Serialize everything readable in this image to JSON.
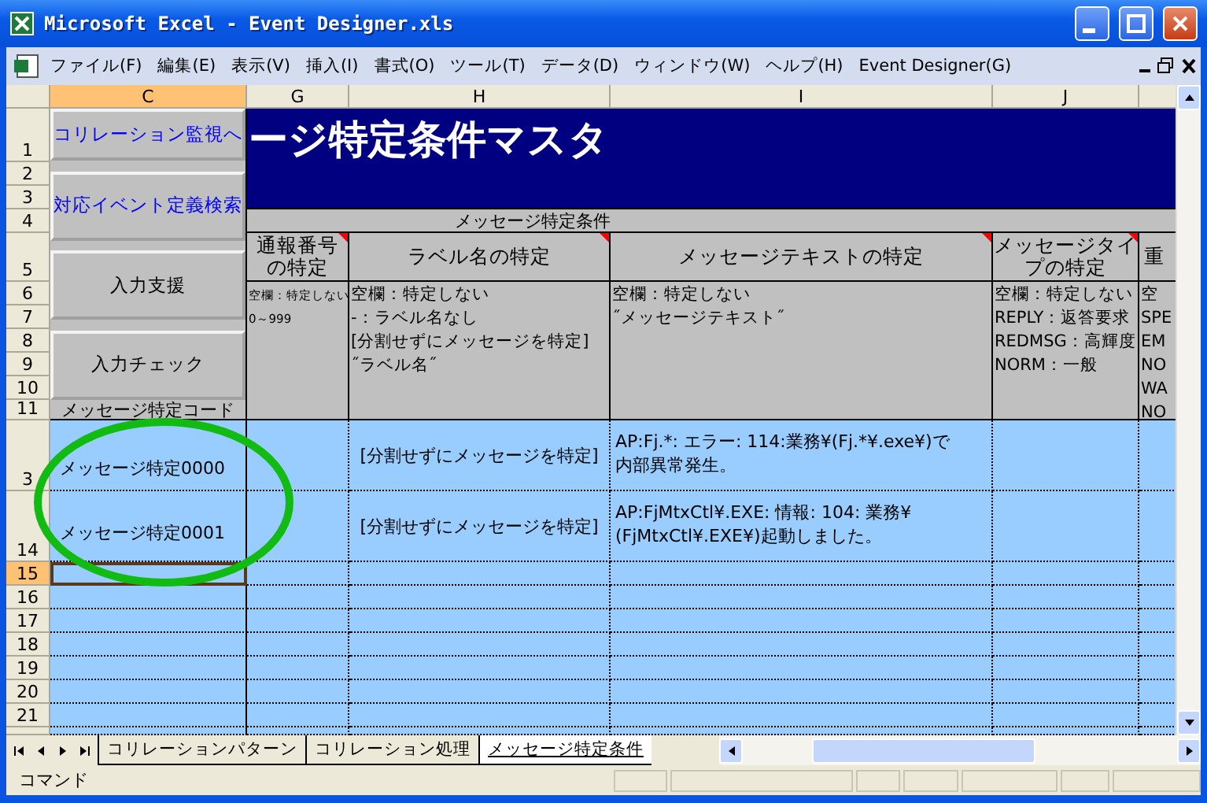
{
  "window": {
    "title": "Microsoft Excel - Event Designer.xls"
  },
  "menu": [
    "ファイル(F)",
    "編集(E)",
    "表示(V)",
    "挿入(I)",
    "書式(O)",
    "ツール(T)",
    "データ(D)",
    "ウィンドウ(W)",
    "ヘルプ(H)",
    "Event Designer(G)"
  ],
  "columns": [
    {
      "label": "C",
      "selected": true
    },
    {
      "label": "G",
      "selected": false
    },
    {
      "label": "H",
      "selected": false
    },
    {
      "label": "I",
      "selected": false
    },
    {
      "label": "J",
      "selected": false
    }
  ],
  "row_numbers": [
    {
      "label": "1",
      "selected": false
    },
    {
      "label": "2",
      "selected": false
    },
    {
      "label": "3",
      "selected": false
    },
    {
      "label": "4",
      "selected": false
    },
    {
      "label": "5",
      "selected": false
    },
    {
      "label": "6",
      "selected": false
    },
    {
      "label": "7",
      "selected": false
    },
    {
      "label": "8",
      "selected": false
    },
    {
      "label": "9",
      "selected": false
    },
    {
      "label": "10",
      "selected": false
    },
    {
      "label": "11",
      "selected": false
    },
    {
      "label": "3",
      "selected": false
    },
    {
      "label": "14",
      "selected": false
    },
    {
      "label": "15",
      "selected": true
    },
    {
      "label": "16",
      "selected": false
    },
    {
      "label": "17",
      "selected": false
    },
    {
      "label": "18",
      "selected": false
    },
    {
      "label": "19",
      "selected": false
    },
    {
      "label": "20",
      "selected": false
    },
    {
      "label": "21",
      "selected": false
    }
  ],
  "sheet_buttons": [
    {
      "label": "コリレーション監視へ",
      "kind": "link"
    },
    {
      "label": "対応イベント定義検索",
      "kind": "link"
    },
    {
      "label": "入力支援",
      "kind": "plain"
    },
    {
      "label": "入力チェック",
      "kind": "plain"
    }
  ],
  "banner": {
    "title": "ージ特定条件マスタ"
  },
  "group_header": "メッセージ特定条件",
  "fields": [
    {
      "header": "通報番号の特定",
      "comment": true,
      "kind": "small",
      "notes": [
        "空欄：特定しない",
        "0～999"
      ]
    },
    {
      "header": "ラベル名の特定",
      "comment": true,
      "kind": "normal",
      "notes": [
        "空欄：特定しない",
        "-：ラベル名なし",
        "[分割せずにメッセージを特定]",
        "˝ラベル名˝"
      ]
    },
    {
      "header": "メッセージテキストの特定",
      "comment": true,
      "kind": "normal",
      "notes": [
        "空欄：特定しない",
        "˝メッセージテキスト˝"
      ]
    },
    {
      "header": "メッセージタイプの特定",
      "comment": true,
      "kind": "normal",
      "notes": [
        "空欄：特定しない",
        "REPLY：返答要求",
        "REDMSG：高輝度",
        "NORM：一般"
      ]
    },
    {
      "header": "重",
      "kind": "normal",
      "notes": [
        "空",
        "SPE",
        "EM",
        "NO",
        "WA",
        "NO"
      ]
    }
  ],
  "code_header": "メッセージ特定コード",
  "records": [
    {
      "code": "メッセージ特定0000",
      "label": "[分割せずにメッセージを特定]",
      "message": "AP:Fj.*: エラー: 114:業務¥(Fj.*¥.exe¥)で内部異常発生。"
    },
    {
      "code": "メッセージ特定0001",
      "label": "[分割せずにメッセージを特定]",
      "message": "AP:FjMtxCtl¥.EXE: 情報: 104: 業務¥(FjMtxCtl¥.EXE¥)起動しました。"
    }
  ],
  "sheet_tabs": [
    {
      "label": "コリレーションパターン",
      "selected": false
    },
    {
      "label": "コリレーション処理",
      "selected": false
    },
    {
      "label": "メッセージ特定条件",
      "selected": true
    }
  ],
  "status_bar": {
    "text": "コマンド"
  }
}
